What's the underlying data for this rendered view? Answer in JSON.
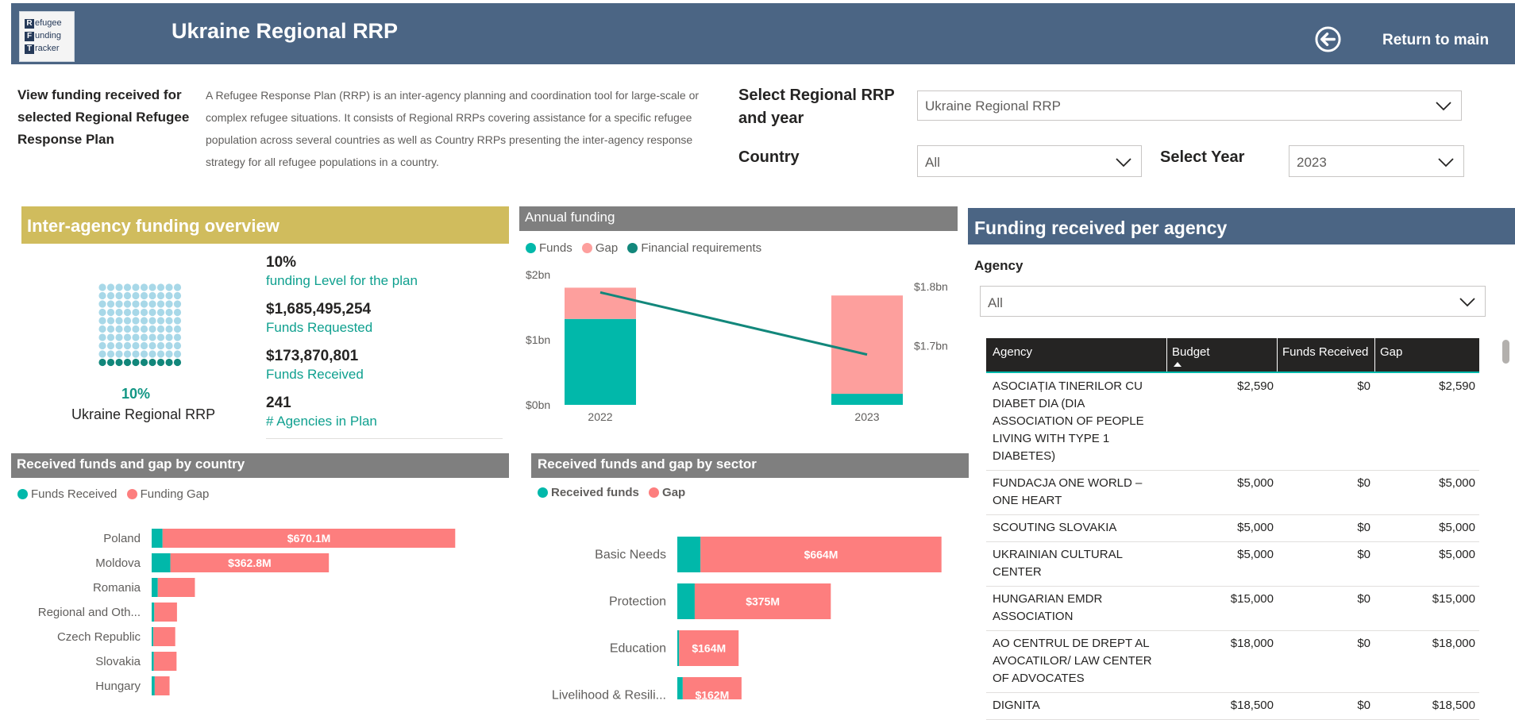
{
  "header": {
    "logo_lines": [
      "efugee",
      "unding",
      "racker"
    ],
    "logo_initials": [
      "R",
      "F",
      "T"
    ],
    "title": "Ukraine Regional RRP",
    "return_label": "Return to main"
  },
  "intro": {
    "view_label": "View funding received for selected Regional Refugee Response Plan",
    "description": "A Refugee Response Plan (RRP) is an inter-agency planning and coordination tool for large-scale or complex refugee situations. It consists of Regional RRPs covering assistance for a specific refugee population across several countries as well as Country RRPs presenting the inter-agency response strategy for all refugee populations in a country."
  },
  "filters": {
    "rrp_label": "Select Regional RRP and year",
    "rrp_value": "Ukraine Regional RRP",
    "country_label": "Country",
    "country_value": "All",
    "year_label": "Select Year",
    "year_value": "2023"
  },
  "overview": {
    "title": "Inter-agency funding overview",
    "funding_pct": "10%",
    "funding_pct_label": "funding Level for the plan",
    "funds_requested": "$1,685,495,254",
    "funds_requested_label": "Funds Requested",
    "funds_received": "$173,870,801",
    "funds_received_label": "Funds Received",
    "agencies": "241",
    "agencies_label": "# Agencies in Plan",
    "waffle_pct": "10%",
    "waffle_plan": "Ukraine Regional RRP",
    "waffle_filled_fraction": 0.1
  },
  "annual": {
    "title": "Annual funding",
    "legend": [
      "Funds",
      "Gap",
      "Financial requirements"
    ],
    "colors": {
      "funds": "#01b8aa",
      "gap": "#fd9f9d",
      "requirements": "#12877b"
    }
  },
  "country": {
    "title": "Received funds and gap by country",
    "legend": [
      "Funds Received",
      "Funding Gap"
    ],
    "colors": {
      "funds": "#01b8aa",
      "gap": "#fd7e7e"
    }
  },
  "sector": {
    "title": "Received funds and gap by sector",
    "legend": [
      "Received funds",
      "Gap"
    ],
    "colors": {
      "funds": "#01b8aa",
      "gap": "#fd7e7e"
    }
  },
  "agency": {
    "title": "Funding received per agency",
    "filter_label": "Agency",
    "filter_value": "All",
    "columns": [
      "Agency",
      "Budget",
      "Funds Received",
      "Gap"
    ],
    "rows": [
      {
        "lines": [
          "ASOCIAȚIA TINERILOR CU",
          "DIABET DIA (DIA",
          "ASSOCIATION OF PEOPLE",
          "LIVING WITH TYPE 1",
          "DIABETES)"
        ],
        "budget": "$2,590",
        "received": "$0",
        "gap": "$2,590"
      },
      {
        "lines": [
          "FUNDACJA ONE WORLD –",
          "ONE HEART"
        ],
        "budget": "$5,000",
        "received": "$0",
        "gap": "$5,000"
      },
      {
        "lines": [
          "SCOUTING SLOVAKIA"
        ],
        "budget": "$5,000",
        "received": "$0",
        "gap": "$5,000"
      },
      {
        "lines": [
          "UKRAINIAN CULTURAL",
          "CENTER"
        ],
        "budget": "$5,000",
        "received": "$0",
        "gap": "$5,000"
      },
      {
        "lines": [
          "HUNGARIAN EMDR",
          "ASSOCIATION"
        ],
        "budget": "$15,000",
        "received": "$0",
        "gap": "$15,000"
      },
      {
        "lines": [
          "AO CENTRUL DE DREPT AL",
          "AVOCATILOR/ LAW CENTER",
          "OF ADVOCATES"
        ],
        "budget": "$18,000",
        "received": "$0",
        "gap": "$18,000"
      },
      {
        "lines": [
          "DIGNITA"
        ],
        "budget": "$18,500",
        "received": "$0",
        "gap": "$18,500"
      }
    ]
  },
  "chart_data": [
    {
      "type": "bar",
      "title": "Annual funding",
      "categories": [
        "2022",
        "2023"
      ],
      "series": [
        {
          "name": "Funds",
          "values": [
            1.32,
            0.17
          ]
        },
        {
          "name": "Gap",
          "values": [
            0.48,
            1.51
          ]
        },
        {
          "name": "Financial requirements",
          "values": [
            1.79,
            1.685
          ]
        }
      ],
      "y_left_ticks": [
        "$0bn",
        "$1bn",
        "$2bn"
      ],
      "y_left_range": [
        0,
        2
      ],
      "y_right_ticks": [
        "$1.7bn",
        "$1.8bn"
      ],
      "y_right_range": [
        1.6,
        1.82
      ]
    },
    {
      "type": "bar",
      "title": "Received funds and gap by country",
      "orientation": "horizontal",
      "categories": [
        "Poland",
        "Moldova",
        "Romania",
        "Regional and Oth...",
        "Czech Republic",
        "Slovakia",
        "Hungary"
      ],
      "series": [
        {
          "name": "Funds Received",
          "values": [
            25,
            43,
            14,
            6,
            4,
            5,
            7
          ]
        },
        {
          "name": "Funding Gap",
          "values": [
            670.1,
            362.8,
            85,
            52,
            50,
            52,
            34
          ]
        }
      ],
      "data_labels": [
        "$670.1M",
        "$362.8M",
        "",
        "",
        "",
        "",
        ""
      ]
    },
    {
      "type": "bar",
      "title": "Received funds and gap by sector",
      "orientation": "horizontal",
      "categories": [
        "Basic Needs",
        "Protection",
        "Education",
        "Livelihood & Resili..."
      ],
      "series": [
        {
          "name": "Received funds",
          "values": [
            64,
            48,
            5,
            15
          ]
        },
        {
          "name": "Gap",
          "values": [
            664,
            375,
            164,
            162
          ]
        }
      ],
      "data_labels": [
        "$664M",
        "$375M",
        "$164M",
        "$162M"
      ]
    }
  ]
}
